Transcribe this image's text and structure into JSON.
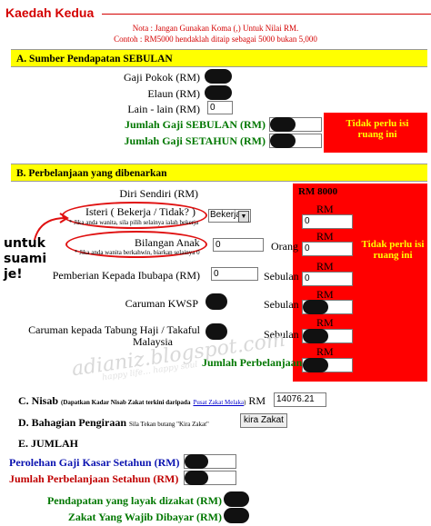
{
  "header": {
    "title": "Kaedah Kedua",
    "note1": "Nota : Jangan Gunakan Koma (,) Untuk Nilai RM.",
    "note2": "Contoh : RM5000 hendaklah ditaip sebagai 5000 bukan 5,000"
  },
  "section_a": {
    "title": "A. Sumber Pendapatan SEBULAN",
    "gaji_pokok": "Gaji Pokok (RM)",
    "elaun": "Elaun (RM)",
    "lain": "Lain - lain (RM)",
    "lain_value": "0",
    "jumlah_sebulan": "Jumlah Gaji SEBULAN (RM)",
    "jumlah_setahun": "Jumlah Gaji SETAHUN (RM)",
    "box_text": "Tidak perlu isi ruang ini"
  },
  "section_b": {
    "title": "B. Perbelanjaan yang dibenarkan",
    "diri": "Diri Sendiri (RM)",
    "rm8000": "RM 8000",
    "isteri": "Isteri ( Bekerja / Tidak? )",
    "isteri_note": "* Jika anda wanita, sila pilih selainya ialah bekerja",
    "isteri_select": "Bekerja",
    "anak": "Bilangan Anak",
    "anak_note": "* Jika anda wanita berkahwin, biarkan selainya 0",
    "anak_value": "0",
    "orang": "Orang",
    "ibubapa": "Pemberian Kepada Ibubapa (RM)",
    "ibubapa_value": "0",
    "sebulan": "Sebulan",
    "kwsp": "Caruman KWSP",
    "tabung_1": "Caruman kepada Tabung Haji / Takaful",
    "tabung_2": "Malaysia",
    "jumlah": "Jumlah Perbelanjaan",
    "rm": "RM",
    "rm_value": "0",
    "box_text": "Tidak perlu isi ruang ini",
    "annotation": "untuk suami je!"
  },
  "section_c": {
    "label": "C. Nisab",
    "note": "(Dapatkan Kadar Nisab Zakat terkini daripada",
    "link": "Pusat Zakat Melaka",
    "note_end": ")",
    "rm": "RM",
    "value": "14076.21"
  },
  "section_d": {
    "label": "D. Bahagian Pengiraan",
    "note": "Sila Tekan butang \"Kira Zakat\"",
    "button": "kira Zakat"
  },
  "section_e": {
    "label": "E. JUMLAH",
    "perolehan": "Perolehan Gaji Kasar Setahun (RM)",
    "perbelanjaan": "Jumlah Perbelanjaan Setahun (RM)",
    "layak": "Pendapatan yang layak dizakat (RM)",
    "wajib": "Zakat Yang Wajib Dibayar (RM)"
  },
  "watermark": {
    "text": "adianiz.blogspot.com",
    "tagline": "happy life... happy soul"
  },
  "colors": {
    "title_red": "#d40000",
    "section_yellow": "#ffff00",
    "box_red": "#ff0000",
    "green_label": "#007700",
    "blue_label": "#0a12b0"
  }
}
